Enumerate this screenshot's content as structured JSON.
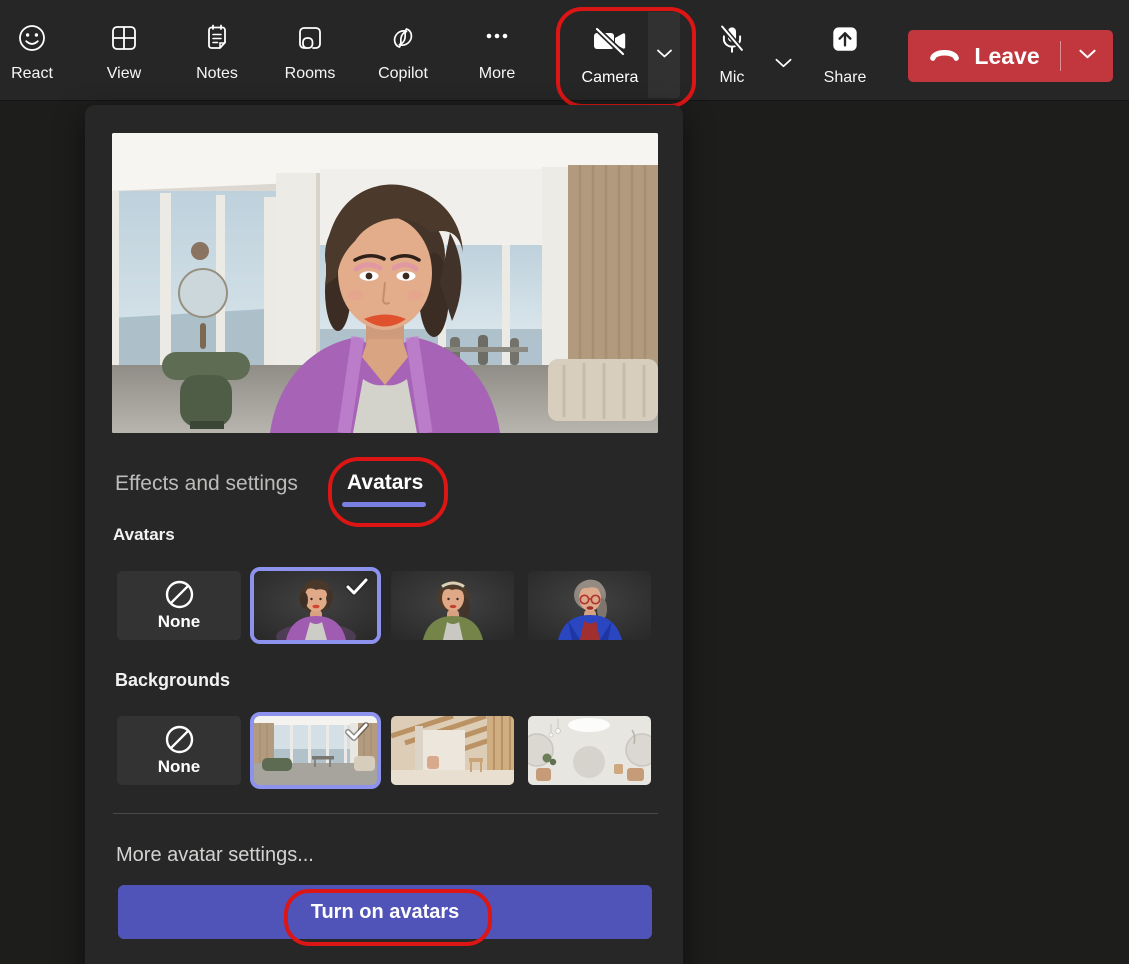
{
  "toolbar": {
    "items": [
      {
        "label": "React"
      },
      {
        "label": "View"
      },
      {
        "label": "Notes"
      },
      {
        "label": "Rooms"
      },
      {
        "label": "Copilot"
      },
      {
        "label": "More"
      }
    ],
    "camera": {
      "label": "Camera",
      "state": "off",
      "has_dropdown": true
    },
    "mic": {
      "label": "Mic",
      "state": "muted",
      "has_dropdown": true
    },
    "share": {
      "label": "Share"
    },
    "leave": {
      "label": "Leave",
      "has_dropdown": true
    }
  },
  "panel": {
    "tabs": {
      "effects": {
        "label": "Effects and settings",
        "active": false
      },
      "avatars": {
        "label": "Avatars",
        "active": true
      }
    },
    "avatars_section": {
      "title": "Avatars",
      "none_label": "None",
      "options": [
        {
          "name": "none",
          "label": "None",
          "selected": false
        },
        {
          "name": "avatar-purple-cardigan",
          "selected": true
        },
        {
          "name": "avatar-green-cardigan",
          "selected": false
        },
        {
          "name": "avatar-blue-blazer",
          "selected": false
        }
      ]
    },
    "backgrounds_section": {
      "title": "Backgrounds",
      "none_label": "None",
      "options": [
        {
          "name": "none",
          "label": "None",
          "selected": false
        },
        {
          "name": "background-modern-lounge",
          "selected": true
        },
        {
          "name": "background-wood-beam-room",
          "selected": false
        },
        {
          "name": "background-white-hall",
          "selected": false
        }
      ]
    },
    "more_settings": {
      "label": "More avatar settings..."
    },
    "turn_on": {
      "label": "Turn on avatars"
    }
  },
  "annotations": {
    "highlight_color": "#dc1515",
    "highlighted": [
      "camera-button",
      "avatars-tab",
      "turn-on-avatars-button"
    ]
  },
  "colors": {
    "accent_purple": "#7a7fe3",
    "selected_border_purple": "#8d92ee",
    "primary_button_purple": "#5054b8",
    "leave_red": "#c2373e",
    "toolbar_bg": "#262626",
    "panel_bg": "#272727"
  }
}
